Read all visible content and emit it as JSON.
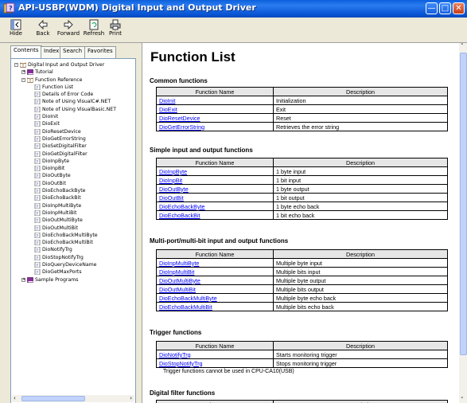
{
  "window": {
    "title": "API-USBP(WDM) Digital Input and Output Driver",
    "colors": {
      "title_bar": "#0a5fdc",
      "link": "#0000ff"
    }
  },
  "toolbar": {
    "buttons": [
      "Hide",
      "Back",
      "Forward",
      "Refresh",
      "Print"
    ]
  },
  "tabs": [
    "Contents",
    "Index",
    "Search",
    "Favorites"
  ],
  "tree": [
    {
      "label": "Digital Input and Output Driver",
      "level": 0,
      "type": "book-open",
      "toggle": "-"
    },
    {
      "label": "Tutorial",
      "level": 1,
      "type": "book-closed",
      "toggle": "+"
    },
    {
      "label": "Function Reference",
      "level": 1,
      "type": "book-open",
      "toggle": "-"
    },
    {
      "label": "Function List",
      "level": 2,
      "type": "page"
    },
    {
      "label": "Details of Error Code",
      "level": 2,
      "type": "page"
    },
    {
      "label": "Note of Using VisualC#.NET",
      "level": 2,
      "type": "page"
    },
    {
      "label": "Note of Using VisualBasic.NET",
      "level": 2,
      "type": "page"
    },
    {
      "label": "DioInit",
      "level": 2,
      "type": "page"
    },
    {
      "label": "DioExit",
      "level": 2,
      "type": "page"
    },
    {
      "label": "DioResetDevice",
      "level": 2,
      "type": "page"
    },
    {
      "label": "DioGetErrorString",
      "level": 2,
      "type": "page"
    },
    {
      "label": "DioSetDigitalFilter",
      "level": 2,
      "type": "page"
    },
    {
      "label": "DioGetDigitalFilter",
      "level": 2,
      "type": "page"
    },
    {
      "label": "DioInpByte",
      "level": 2,
      "type": "page"
    },
    {
      "label": "DioInpBit",
      "level": 2,
      "type": "page"
    },
    {
      "label": "DioOutByte",
      "level": 2,
      "type": "page"
    },
    {
      "label": "DioOutBit",
      "level": 2,
      "type": "page"
    },
    {
      "label": "DioEchoBackByte",
      "level": 2,
      "type": "page"
    },
    {
      "label": "DioEchoBackBit",
      "level": 2,
      "type": "page"
    },
    {
      "label": "DioInpMultiByte",
      "level": 2,
      "type": "page"
    },
    {
      "label": "DioInpMultiBit",
      "level": 2,
      "type": "page"
    },
    {
      "label": "DioOutMultiByte",
      "level": 2,
      "type": "page"
    },
    {
      "label": "DioOutMultiBit",
      "level": 2,
      "type": "page"
    },
    {
      "label": "DioEchoBackMultiByte",
      "level": 2,
      "type": "page"
    },
    {
      "label": "DioEchoBackMultiBit",
      "level": 2,
      "type": "page"
    },
    {
      "label": "DioNotifyTrg",
      "level": 2,
      "type": "page"
    },
    {
      "label": "DioStopNotifyTrg",
      "level": 2,
      "type": "page"
    },
    {
      "label": "DioQueryDeviceName",
      "level": 2,
      "type": "page"
    },
    {
      "label": "DioGetMaxPorts",
      "level": 2,
      "type": "page"
    },
    {
      "label": "Sample Programs",
      "level": 1,
      "type": "book-closed",
      "toggle": "+"
    }
  ],
  "content": {
    "title": "Function List",
    "col_name": "Function Name",
    "col_desc": "Description",
    "sections": [
      {
        "heading": "Common functions",
        "rows": [
          [
            "DioInit",
            "Initialization"
          ],
          [
            "DioExit",
            "Exit"
          ],
          [
            "DioResetDevice",
            "Reset"
          ],
          [
            "DioGetErrorString",
            "Retrieves the error string"
          ]
        ]
      },
      {
        "heading": "Simple input and output functions",
        "rows": [
          [
            "DioInpByte",
            "1 byte input"
          ],
          [
            "DioInpBit",
            "1 bit input"
          ],
          [
            "DioOutByte",
            "1 byte output"
          ],
          [
            "DioOutBit",
            "1 bit output"
          ],
          [
            "DioEchoBackByte",
            "1 byte echo back"
          ],
          [
            "DioEchoBackBit",
            "1 bit echo back"
          ]
        ]
      },
      {
        "heading": "Multi-port/multi-bit input and output functions",
        "rows": [
          [
            "DioInpMultiByte",
            "Multiple byte input"
          ],
          [
            "DioInpMultiBit",
            "Multiple bits input"
          ],
          [
            "DioOutMultiByte",
            "Multiple byte output"
          ],
          [
            "DioOutMultiBit",
            "Multiple bits output"
          ],
          [
            "DioEchoBackMultiByte",
            "Multiple byte echo back"
          ],
          [
            "DioEchoBackMultiBit",
            "Multiple bits echo back"
          ]
        ]
      },
      {
        "heading": "Trigger functions",
        "rows": [
          [
            "DioNotifyTrg",
            "Starts monitoring trigger"
          ],
          [
            "DioStopNotifyTrg",
            "Stops monitoring trigger"
          ]
        ],
        "note": "Trigger functions cannot be used in CPU-CA10(USB)"
      },
      {
        "heading": "Digital filter functions",
        "rows": []
      }
    ]
  }
}
